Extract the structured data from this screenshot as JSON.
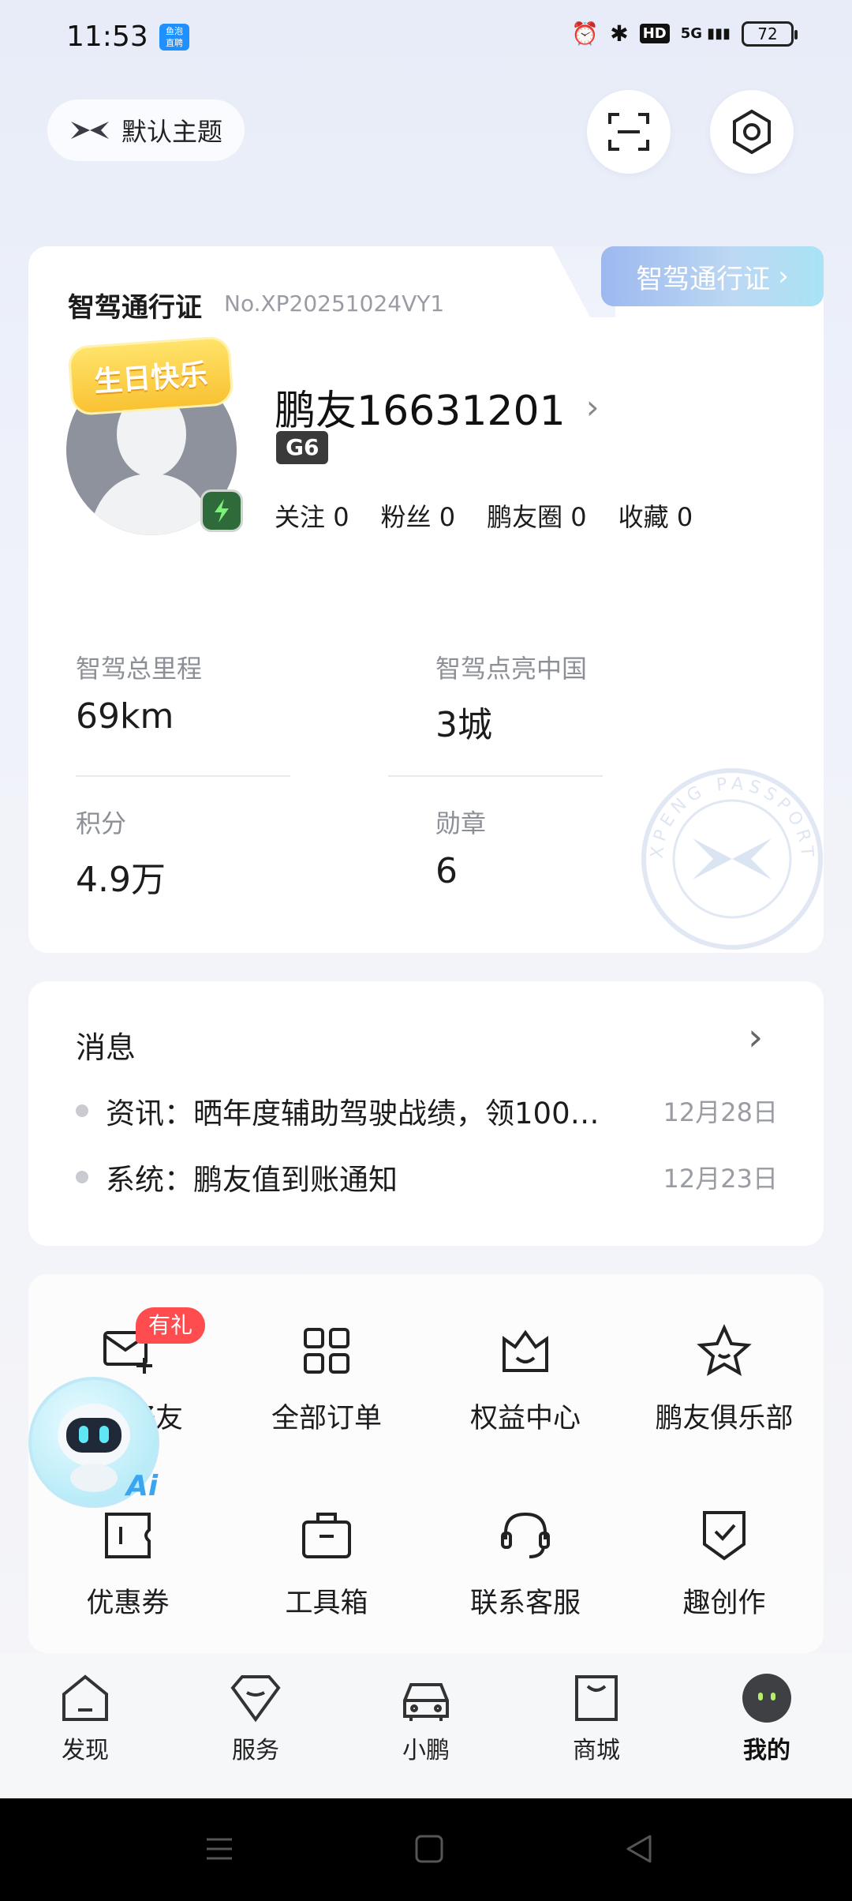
{
  "status_bar": {
    "time": "11:53",
    "app_badge": "鱼泡\n直聘",
    "hd": "HD",
    "network": "5G",
    "battery": "72"
  },
  "header": {
    "theme_label": "默认主题"
  },
  "passport": {
    "tab_label": "智驾通行证",
    "title": "智驾通行证",
    "number": "No.XP20251024VY1",
    "birthday_sticker": "生日快乐",
    "username": "鹏友16631201",
    "model_tag": "G6",
    "social": [
      {
        "label": "关注",
        "count": "0"
      },
      {
        "label": "粉丝",
        "count": "0"
      },
      {
        "label": "鹏友圈",
        "count": "0"
      },
      {
        "label": "收藏",
        "count": "0"
      }
    ],
    "stats": [
      {
        "label": "智驾总里程",
        "value": "69km"
      },
      {
        "label": "智驾点亮中国",
        "value": "3城"
      },
      {
        "label": "积分",
        "value": "4.9万"
      },
      {
        "label": "勋章",
        "value": "6"
      }
    ],
    "stamp_text": "XPENG PASSPORT"
  },
  "messages": {
    "title": "消息",
    "items": [
      {
        "text": "资讯：晒年度辅助驾驶战绩，领100…",
        "date": "12月28日"
      },
      {
        "text": "系统：鹏友值到账通知",
        "date": "12月23日"
      }
    ]
  },
  "services": {
    "gift_badge": "有礼",
    "items": [
      {
        "label": "邀请好友",
        "icon": "mail-plus-icon"
      },
      {
        "label": "全部订单",
        "icon": "grid-icon"
      },
      {
        "label": "权益中心",
        "icon": "crown-box-icon"
      },
      {
        "label": "鹏友俱乐部",
        "icon": "star-icon"
      },
      {
        "label": "优惠券",
        "icon": "coupon-icon"
      },
      {
        "label": "工具箱",
        "icon": "toolbox-icon"
      },
      {
        "label": "联系客服",
        "icon": "headset-icon"
      },
      {
        "label": "趣创作",
        "icon": "badge-check-icon"
      }
    ],
    "ai_label": "Ai"
  },
  "bottom_nav": {
    "items": [
      {
        "label": "发现",
        "icon": "house-icon",
        "active": false
      },
      {
        "label": "服务",
        "icon": "diamond-icon",
        "active": false
      },
      {
        "label": "小鹏",
        "icon": "car-icon",
        "active": false
      },
      {
        "label": "商城",
        "icon": "shopping-bag-icon",
        "active": false
      },
      {
        "label": "我的",
        "icon": "avatar-icon",
        "active": true
      }
    ]
  },
  "colors": {
    "accent_red": "#ff4d4f",
    "passport_tab": "#9db8ef",
    "text_primary": "#1c1c1e",
    "text_secondary": "#8c8f96"
  }
}
